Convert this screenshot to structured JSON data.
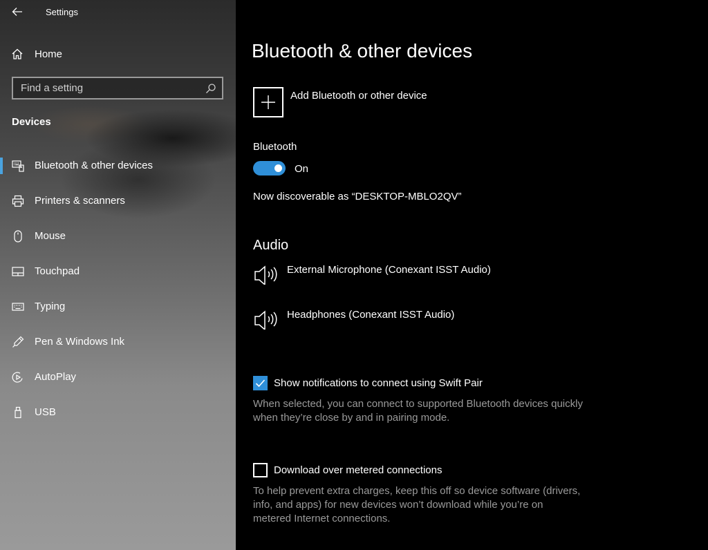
{
  "window": {
    "title": "Settings"
  },
  "sidebar": {
    "home_label": "Home",
    "search_placeholder": "Find a setting",
    "section_label": "Devices",
    "items": [
      {
        "label": "Bluetooth & other devices",
        "icon": "bluetooth-devices-icon",
        "active": true
      },
      {
        "label": "Printers & scanners",
        "icon": "printer-icon"
      },
      {
        "label": "Mouse",
        "icon": "mouse-icon"
      },
      {
        "label": "Touchpad",
        "icon": "touchpad-icon"
      },
      {
        "label": "Typing",
        "icon": "keyboard-icon"
      },
      {
        "label": "Pen & Windows Ink",
        "icon": "pen-icon"
      },
      {
        "label": "AutoPlay",
        "icon": "autoplay-icon"
      },
      {
        "label": "USB",
        "icon": "usb-icon"
      }
    ]
  },
  "main": {
    "title": "Bluetooth & other devices",
    "add_device_label": "Add Bluetooth or other device",
    "bluetooth": {
      "label": "Bluetooth",
      "state": "On",
      "discoverable": "Now discoverable as “DESKTOP-MBLO2QV”"
    },
    "audio": {
      "title": "Audio",
      "devices": [
        {
          "name": "External Microphone (Conexant ISST Audio)",
          "icon": "speaker-icon"
        },
        {
          "name": "Headphones (Conexant ISST Audio)",
          "icon": "speaker-icon"
        }
      ]
    },
    "swift_pair": {
      "label": "Show notifications to connect using Swift Pair",
      "checked": true,
      "description_line1": "When selected, you can connect to supported Bluetooth devices quickly",
      "description_line2": "when they’re close by and in pairing mode."
    },
    "metered": {
      "label": "Download over metered connections",
      "checked": false,
      "description_line1": "To help prevent extra charges, keep this off so device software (drivers,",
      "description_line2": "info, and apps) for new devices won’t download while you’re on",
      "description_line3": "metered Internet connections."
    }
  },
  "colors": {
    "accent": "#2f8fd8",
    "active_indicator": "#4aa3df"
  }
}
